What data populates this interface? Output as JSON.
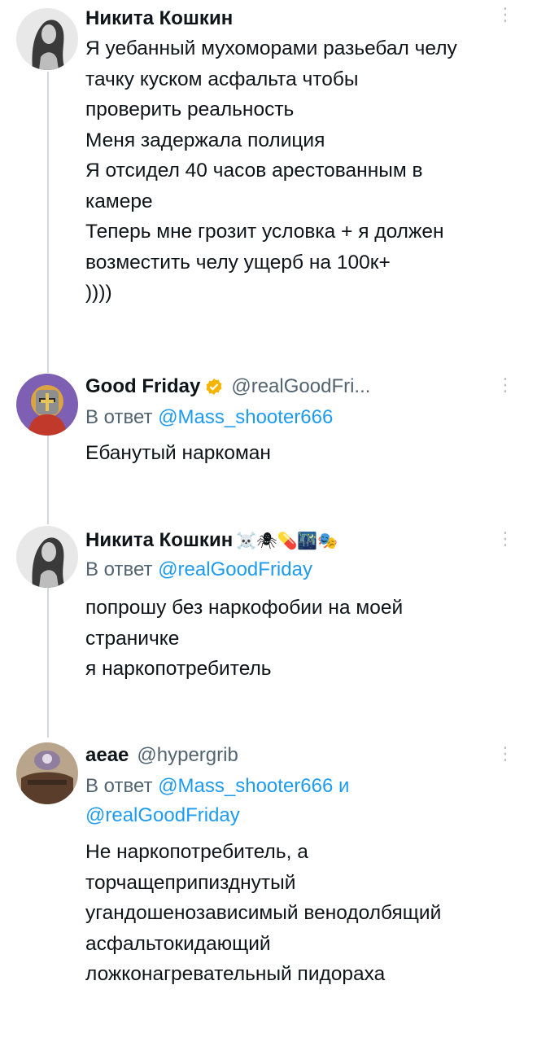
{
  "tweets": [
    {
      "name": "Никита Кошкин",
      "emojis": "",
      "handle": "",
      "reply_prefix": "",
      "reply_mentions": [],
      "lines": [
        "Я уебанный мухоморами разьебал челу",
        "тачку куском асфальта чтобы",
        "проверить реальность",
        "Меня задержала полиция",
        "Я отсидел 40 часов арестованным в",
        "камере",
        "Теперь мне грозит условка + я должен",
        "возместить челу ущерб на 100к+",
        "))))"
      ]
    },
    {
      "name": "Good Friday",
      "emojis": "",
      "handle": "@realGoodFri...",
      "reply_prefix": "В ответ",
      "reply_mentions": [
        "@Mass_shooter666"
      ],
      "lines": [
        "Ебанутый наркоман"
      ]
    },
    {
      "name": "Никита Кошкин",
      "emojis": "☠️🕷💊🌃🎭",
      "handle": "",
      "reply_prefix": "В ответ",
      "reply_mentions": [
        "@realGoodFriday"
      ],
      "lines": [
        "попрошу без наркофобии на моей",
        "страничке",
        "я наркопотребитель"
      ]
    },
    {
      "name": "aeae",
      "emojis": "",
      "handle": "@hypergrib",
      "reply_prefix": "В ответ",
      "reply_mentions": [
        "@Mass_shooter666",
        "@realGoodFriday"
      ],
      "reply_joiner": "и",
      "lines": [
        "Не наркопотребитель, а",
        "торчащеприпизднутый",
        "угандошенозависимый венодолбящий",
        "асфальтокидающий",
        "ложконагревательный пидораха"
      ]
    }
  ],
  "colors": {
    "text": "#0f1419",
    "secondary": "#536471",
    "mention": "#1d9bf0",
    "thread_line": "#cfd9de",
    "verified": "#f4b400"
  },
  "icons": [
    "avatar-photo",
    "knight-avatar",
    "verified-badge-icon",
    "more-options-icon"
  ]
}
